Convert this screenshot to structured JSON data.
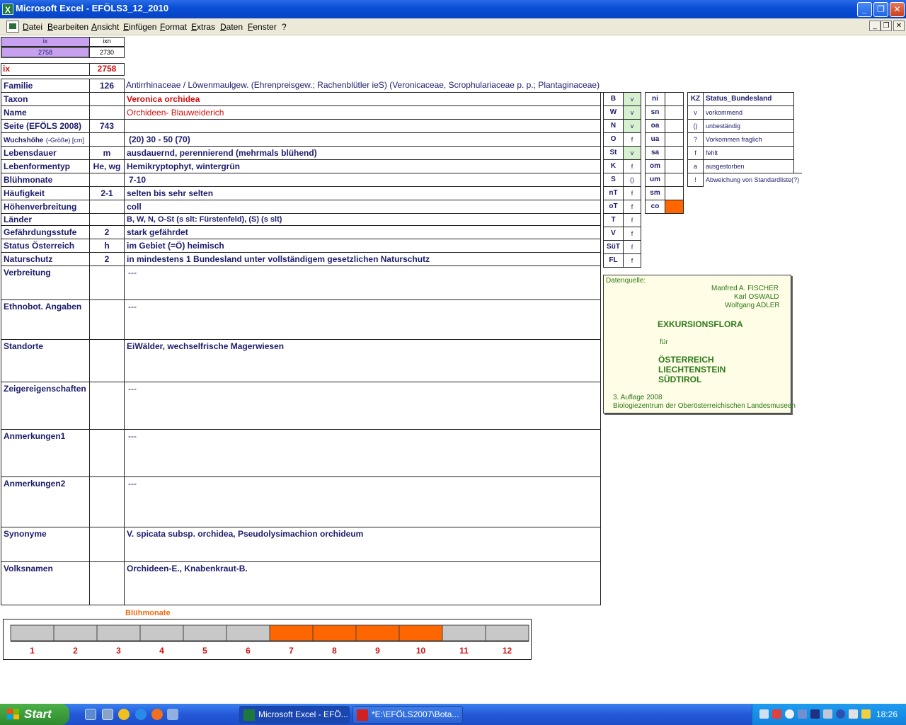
{
  "window": {
    "title": "Microsoft Excel - EFÖLS3_12_2010",
    "app_icon": "X",
    "buttons": {
      "minimize": "_",
      "restore": "❐",
      "close": "✕"
    }
  },
  "menu": {
    "items": [
      "Datei",
      "Bearbeiten",
      "Ansicht",
      "Einfügen",
      "Format",
      "Extras",
      "Daten",
      "Fenster",
      "?"
    ],
    "mdi": {
      "minimize": "_",
      "restore": "❐",
      "close": "✕"
    }
  },
  "index_table": {
    "header_left": "ix",
    "header_right": "ixn",
    "value_left": "2758",
    "value_right": "2730",
    "ix_label": "ix",
    "ix_value": "2758"
  },
  "record": [
    {
      "label": "Familie",
      "num": "126",
      "value": "Antirrhinaceae  /  Löwenmaulgew. (Ehrenpreisgew.; Rachenblütler ieS) (Veronicaceae, Scrophulariaceae p. p.; Plantaginaceae)"
    },
    {
      "label": "Taxon",
      "num": "",
      "value": "Veronica orchidea"
    },
    {
      "label": "Name",
      "num": "",
      "value": "Orchideen- Blauweiderich"
    },
    {
      "label": "Seite (EFÖLS 2008)",
      "num": "743",
      "value": ""
    },
    {
      "label": "Wuchshöhe",
      "label_small": "(-Größe) [cm]",
      "num": "",
      "value": "(20) 30 - 50 (70)"
    },
    {
      "label": "Lebensdauer",
      "num": "m",
      "value": "ausdauernd, perennierend (mehrmals blühend)"
    },
    {
      "label": "Lebenformentyp",
      "num": "He, wg",
      "value": "Hemikryptophyt, wintergrün"
    },
    {
      "label": "Blühmonate",
      "num": "",
      "value": "7-10"
    },
    {
      "label": "Häufigkeit",
      "num": "2-1",
      "value": "selten bis sehr selten"
    },
    {
      "label": "Höhenverbreitung",
      "num": "",
      "value": "coll"
    },
    {
      "label": "Länder",
      "num": "",
      "value": "B, W, N, O-St (s slt: Fürstenfeld), (S) (s slt)"
    },
    {
      "label": "Gefährdungsstufe",
      "num": "2",
      "value": "stark gefährdet"
    },
    {
      "label": "Status Österreich",
      "num": "h",
      "value": "im Gebiet (=Ö) heimisch"
    },
    {
      "label": "Naturschutz",
      "num": "2",
      "value": "in mindestens 1 Bundesland unter vollständigem gesetzlichen Naturschutz"
    },
    {
      "label": "Verbreitung",
      "num": "",
      "value": "---"
    },
    {
      "label": "Ethnobot. Angaben",
      "num": "",
      "value": "---"
    },
    {
      "label": "Standorte",
      "num": "",
      "value": "EiWälder, wechselfrische Magerwiesen"
    },
    {
      "label": "Zeigereigenschaften",
      "num": "",
      "value": "---"
    },
    {
      "label": "Anmerkungen1",
      "num": "",
      "value": "---"
    },
    {
      "label": "Anmerkungen2",
      "num": "",
      "value": "---"
    },
    {
      "label": "Synonyme",
      "num": "",
      "value": "V. spicata subsp. orchidea, Pseudolysimachion orchideum"
    },
    {
      "label": "Volksnamen",
      "num": "",
      "value": "Orchideen-E., Knabenkraut-B."
    }
  ],
  "states": [
    {
      "code": "B",
      "status": "v",
      "present": true
    },
    {
      "code": "W",
      "status": "v",
      "present": true
    },
    {
      "code": "N",
      "status": "v",
      "present": true
    },
    {
      "code": "O",
      "status": "f",
      "present": false
    },
    {
      "code": "St",
      "status": "v",
      "present": true
    },
    {
      "code": "K",
      "status": "f",
      "present": false
    },
    {
      "code": "S",
      "status": "()",
      "present": false
    },
    {
      "code": "nT",
      "status": "f",
      "present": false
    },
    {
      "code": "oT",
      "status": "f",
      "present": false
    },
    {
      "code": "T",
      "status": "f",
      "present": false
    },
    {
      "code": "V",
      "status": "f",
      "present": false
    },
    {
      "code": "SüT",
      "status": "f",
      "present": false
    },
    {
      "code": "FL",
      "status": "f",
      "present": false
    }
  ],
  "altitudes": [
    {
      "code": "ni",
      "marked": false
    },
    {
      "code": "sn",
      "marked": false
    },
    {
      "code": "oa",
      "marked": false
    },
    {
      "code": "ua",
      "marked": false
    },
    {
      "code": "sa",
      "marked": false
    },
    {
      "code": "om",
      "marked": false
    },
    {
      "code": "um",
      "marked": false
    },
    {
      "code": "sm",
      "marked": false
    },
    {
      "code": "co",
      "marked": true
    }
  ],
  "legend": {
    "header_code": "KZ",
    "header_text": "Status_Bundesland",
    "rows": [
      {
        "code": "v",
        "text": "vorkommend"
      },
      {
        "code": "()",
        "text": "unbeständig"
      },
      {
        "code": "?",
        "text": "Vorkommen fraglich"
      },
      {
        "code": "f",
        "text": "fehlt"
      },
      {
        "code": "a",
        "text": "ausgestorben"
      },
      {
        "code": "!",
        "text": "Abweichung von Standardliste(?)"
      }
    ]
  },
  "source": {
    "label": "Datenquelle:",
    "authors": [
      "Manfred A. FISCHER",
      "Karl OSWALD",
      "Wolfgang ADLER"
    ],
    "title": "EXKURSIONSFLORA",
    "for": "für",
    "countries": [
      "ÖSTERREICH",
      "LIECHTENSTEIN",
      "SÜDTIROL"
    ],
    "edition": "3. Auflage 2008",
    "publisher": "Biologiezentrum der Oberösterreichischen Landesmuseen"
  },
  "chart_data": {
    "type": "bar",
    "title": "Blühmonate",
    "categories": [
      "1",
      "2",
      "3",
      "4",
      "5",
      "6",
      "7",
      "8",
      "9",
      "10",
      "11",
      "12"
    ],
    "values": [
      0,
      0,
      0,
      0,
      0,
      0,
      1,
      1,
      1,
      1,
      0,
      0
    ],
    "colors": {
      "active": "#ff6600",
      "inactive": "#c8c8c8",
      "labels": "#d01010"
    }
  },
  "taskbar": {
    "start": "Start",
    "tasks": [
      {
        "label": "Microsoft Excel - EFÖ...",
        "active": true
      },
      {
        "label": "*E:\\EFÖLS2007\\Bota...",
        "active": false
      }
    ],
    "clock": "18:26"
  },
  "colors": {
    "purple_header": "#c8a0f0",
    "present_green": "#d6f0d0",
    "orange": "#ff6600",
    "text_navy": "#1c1c6c",
    "red": "#d01010"
  }
}
